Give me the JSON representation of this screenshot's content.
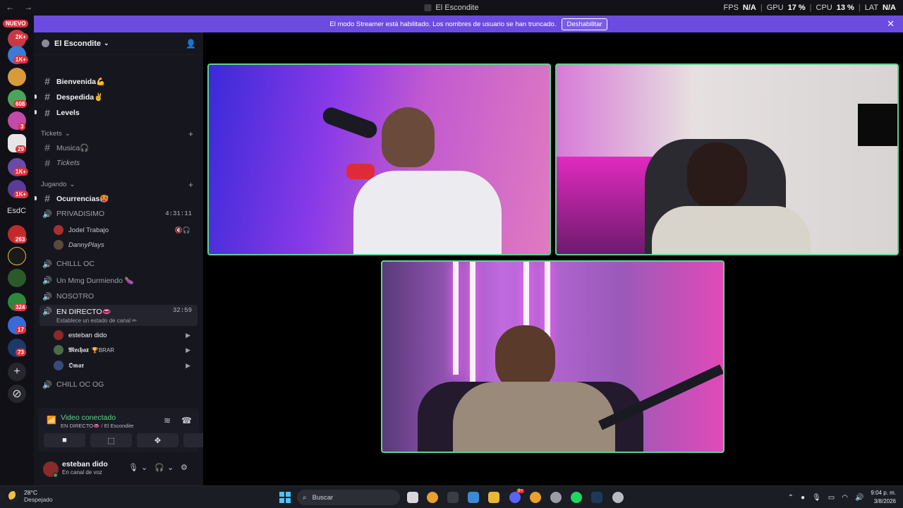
{
  "titlebar": {
    "back": "←",
    "forward": "→",
    "title": "El Escondite",
    "perf": {
      "fps_label": "FPS",
      "fps_value": "N/A",
      "gpu_label": "GPU",
      "gpu_value": "17 %",
      "cpu_label": "CPU",
      "cpu_value": "13 %",
      "lat_label": "LAT",
      "lat_value": "N/A"
    }
  },
  "rail": {
    "nuevo": "NUEVO",
    "badges": [
      "2K+",
      "1K+",
      "608",
      "3",
      "29",
      "1K+",
      "1K+",
      "263",
      "324",
      "17",
      "73"
    ],
    "esdc": "EsdC",
    "add_icon": "+",
    "discover_icon": "⊘"
  },
  "banner": {
    "text": "El modo Streamer está habilitado. Los nombres de usuario se han truncado.",
    "button": "Deshabilitar",
    "close": "✕"
  },
  "server": {
    "name": "El Escondite"
  },
  "channels": {
    "bienvenida": "Bienvenida💪",
    "despedida": "Despedida✌️",
    "levels": "Levels",
    "cat_tickets": "Tickets",
    "musica": "Musica🎧",
    "tickets": "Tickets",
    "cat_jugando": "Jugando",
    "ocurrencias": "Ocurrencias🥵",
    "privadisimo": "PRIVADISIMO",
    "privadisimo_time": "4:31:11",
    "u1": "Jodel Trabajo",
    "u2": "DannyPlays",
    "chilll": "CHILLL OC",
    "mmg": "Un Mmg Durmiendo 🍆",
    "nosotro": "NOSOTRO",
    "endirecto": "EN DIRECTO👄",
    "endirecto_time": "32:59",
    "endirecto_sub": "Establece un estado de canal ✏",
    "u3": "esteban dido",
    "u4": "𝕸𝖊𝖈𝖍𝖆𝖝",
    "u4_tag": "🏆BRAR",
    "u5": "𝕺𝖒𝖆𝖗",
    "chilloc": "CHILL OC OG"
  },
  "voice": {
    "title": "Video conectado",
    "sub": "EN DIRECTO👄 / El Escondite"
  },
  "user": {
    "name": "esteban dido",
    "status": "En canal de voz"
  },
  "taskbar": {
    "temp": "28°C",
    "weather": "Despejado",
    "search": "Buscar",
    "time": "9:04 p. m.",
    "date": "3/8/2026",
    "discord_badge": "9+"
  },
  "colors": {
    "accent": "#6c4ce0",
    "green": "#5fd38c",
    "red_badge": "#e0323c"
  }
}
